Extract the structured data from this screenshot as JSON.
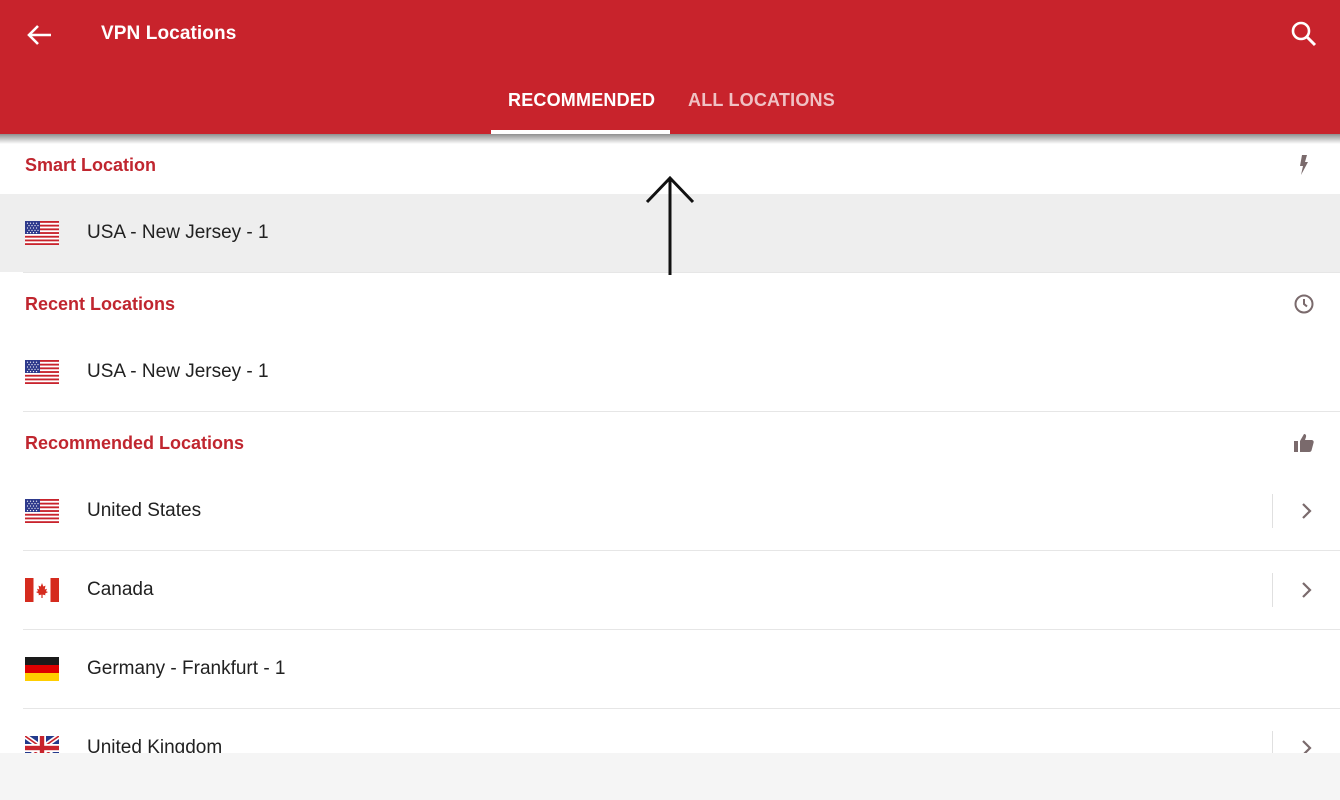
{
  "colors": {
    "brand": "#c8232c",
    "accent": "#c0262f",
    "icon_gray": "#7a6a6c"
  },
  "header": {
    "title": "VPN Locations",
    "back_icon": "arrow-left-icon",
    "search_icon": "search-icon"
  },
  "tabs": [
    {
      "label": "RECOMMENDED",
      "active": true
    },
    {
      "label": "ALL LOCATIONS",
      "active": false
    }
  ],
  "sections": {
    "smart": {
      "title": "Smart Location",
      "icon": "lightning-bolt-icon",
      "items": [
        {
          "label": "USA - New Jersey - 1",
          "flag": "us-flag-icon",
          "selected": true
        }
      ]
    },
    "recent": {
      "title": "Recent Locations",
      "icon": "clock-icon",
      "items": [
        {
          "label": "USA - New Jersey - 1",
          "flag": "us-flag-icon"
        }
      ]
    },
    "recommended": {
      "title": "Recommended Locations",
      "icon": "thumbs-up-icon",
      "items": [
        {
          "label": "United States",
          "flag": "us-flag-icon",
          "expandable": true
        },
        {
          "label": "Canada",
          "flag": "ca-flag-icon",
          "expandable": true
        },
        {
          "label": "Germany - Frankfurt - 1",
          "flag": "de-flag-icon",
          "expandable": false
        },
        {
          "label": "United Kingdom",
          "flag": "uk-flag-icon",
          "expandable": true
        }
      ]
    }
  },
  "annotation": {
    "icon": "up-arrow-annotation-icon"
  }
}
